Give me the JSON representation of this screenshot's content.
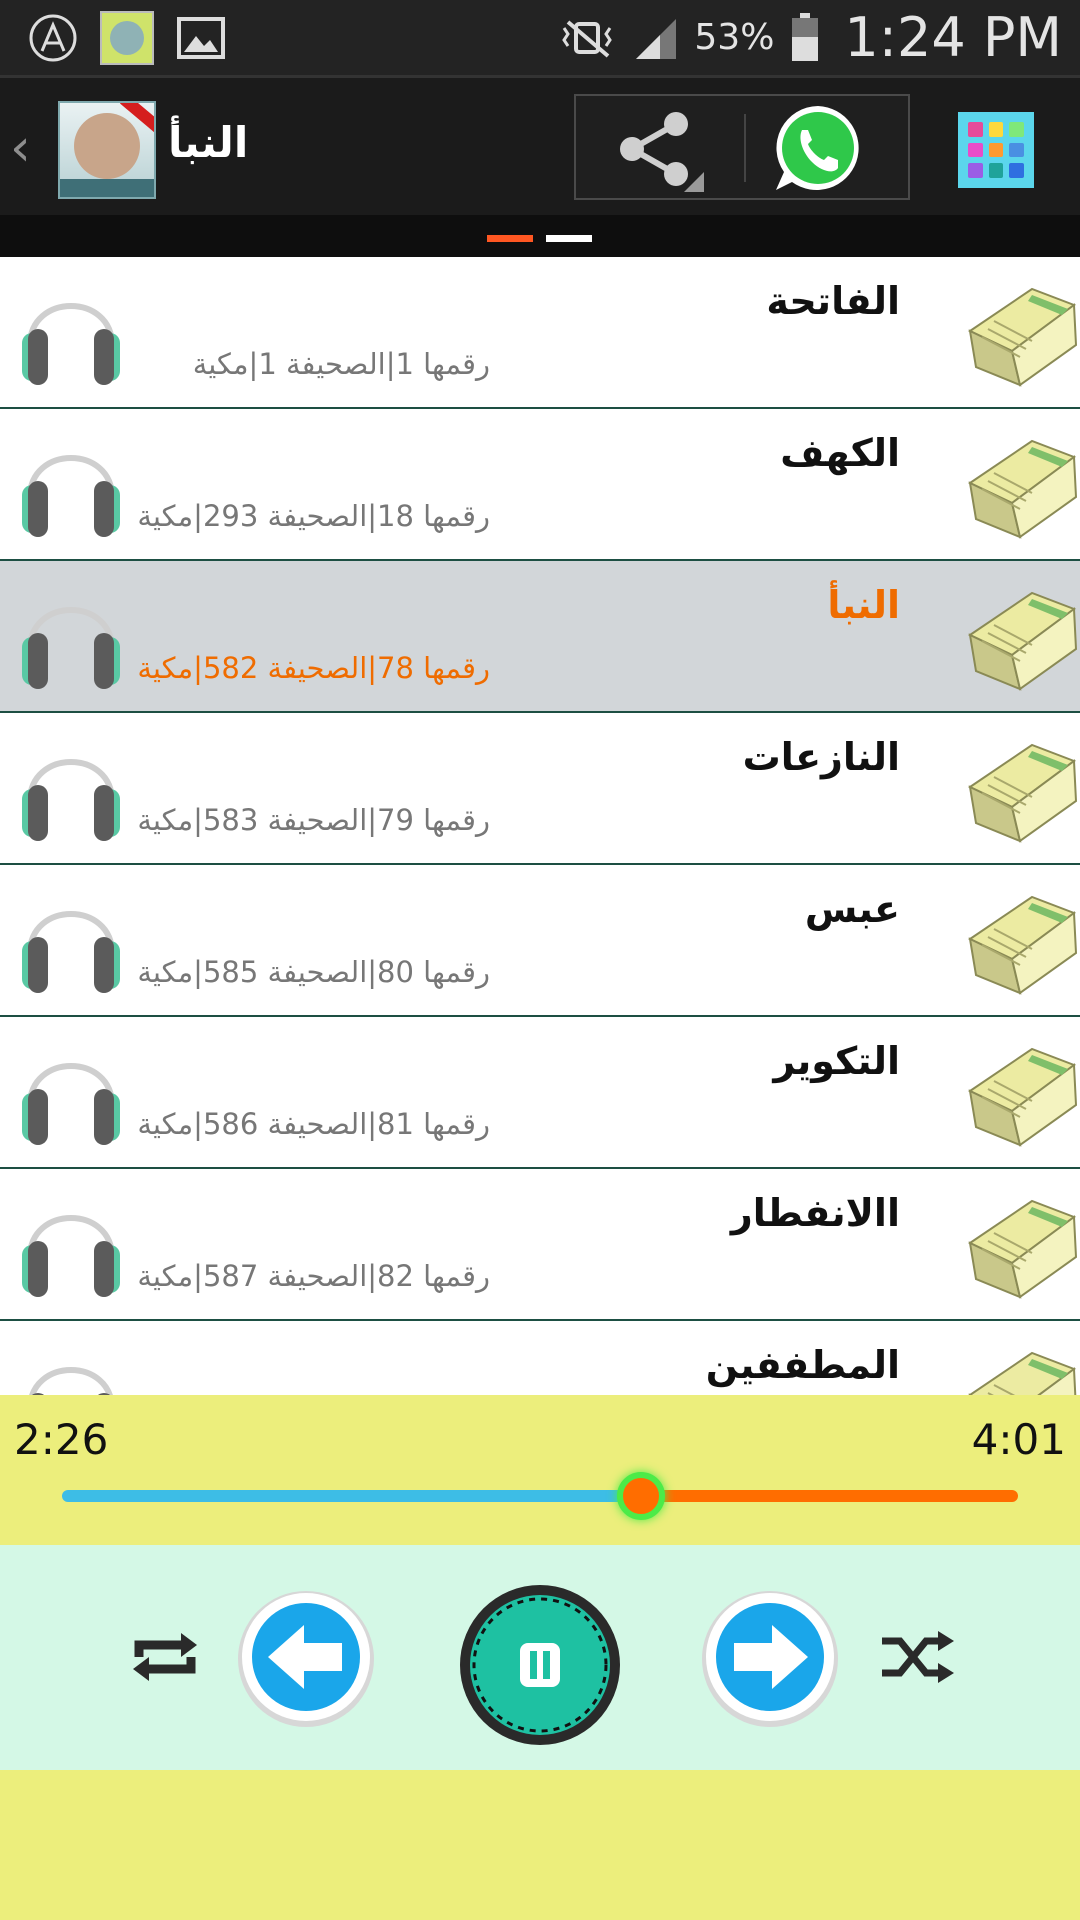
{
  "status_bar": {
    "battery_percent": "53%",
    "time": "1:24 PM",
    "icons": [
      "app-a-icon",
      "app-thumbnail-icon",
      "gallery-icon",
      "vibrate-icon",
      "signal-icon",
      "battery-icon"
    ]
  },
  "toolbar": {
    "title": "النبأ",
    "back_icon": "‹",
    "actions": [
      "share-icon",
      "whatsapp-icon",
      "apps-grid-icon"
    ]
  },
  "pager": {
    "pages": 2,
    "active_index": 0
  },
  "surahs": [
    {
      "name": "الفاتحة",
      "number": "1",
      "page": "1",
      "type": "مكية",
      "selected": false
    },
    {
      "name": "الكهف",
      "number": "18",
      "page": "293",
      "type": "مكية",
      "selected": false
    },
    {
      "name": "النبأ",
      "number": "78",
      "page": "582",
      "type": "مكية",
      "selected": true
    },
    {
      "name": "النازعات",
      "number": "79",
      "page": "583",
      "type": "مكية",
      "selected": false
    },
    {
      "name": "عبس",
      "number": "80",
      "page": "585",
      "type": "مكية",
      "selected": false
    },
    {
      "name": "التكوير",
      "number": "81",
      "page": "586",
      "type": "مكية",
      "selected": false
    },
    {
      "name": "االانفطار",
      "number": "82",
      "page": "587",
      "type": "مكية",
      "selected": false
    },
    {
      "name": "المطففين",
      "number": "",
      "page": "",
      "type": "",
      "selected": false
    }
  ],
  "labels": {
    "number_word": "رقمها",
    "page_word": "الصحيفة",
    "separator": "|"
  },
  "player": {
    "current_time": "2:26",
    "total_time": "4:01",
    "progress_fraction": 0.606,
    "controls": [
      "repeat-icon",
      "previous-icon",
      "pause-icon",
      "next-icon",
      "shuffle-icon"
    ]
  },
  "colors": {
    "accent_orange": "#ff6d00",
    "seek_played": "#3dbde6",
    "panel_yellow": "#ecee7c",
    "controls_bg": "#d4f8e6",
    "selected_row": "#d2d6d9"
  }
}
